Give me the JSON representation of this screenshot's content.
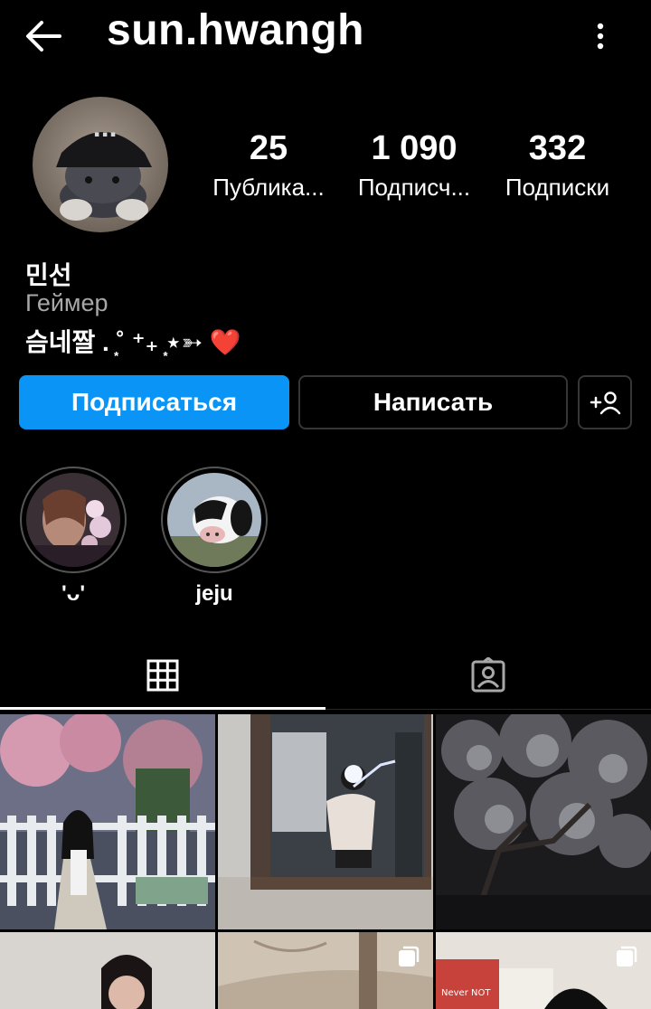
{
  "header": {
    "username": "sun.hwangh",
    "back_icon": "arrow-left-icon",
    "menu_icon": "more-vertical-icon"
  },
  "profile": {
    "stats": [
      {
        "value": "25",
        "label": "Публика..."
      },
      {
        "value": "1 090",
        "label": "Подписч..."
      },
      {
        "value": "332",
        "label": "Подписки"
      }
    ],
    "name": "민선",
    "category": "Геймер",
    "bio_text": "슴네짤 . ͙˚ ⁺₊ ͙⋆➳ ",
    "bio_emoji": "❤️"
  },
  "actions": {
    "follow_label": "Подписаться",
    "message_label": "Написать",
    "add_icon": "add-person-icon",
    "follow_color": "#0a95f6"
  },
  "highlights": [
    {
      "label": "'ᴗ'"
    },
    {
      "label": "jeju"
    }
  ],
  "tabs": [
    {
      "icon": "grid-icon",
      "active": true
    },
    {
      "icon": "tagged-icon",
      "active": false
    }
  ],
  "grid": {
    "posts": [
      {
        "multi": false
      },
      {
        "multi": false
      },
      {
        "multi": false
      },
      {
        "multi": false
      },
      {
        "multi": true
      },
      {
        "multi": true
      }
    ],
    "partial_text": "Never NOT"
  }
}
